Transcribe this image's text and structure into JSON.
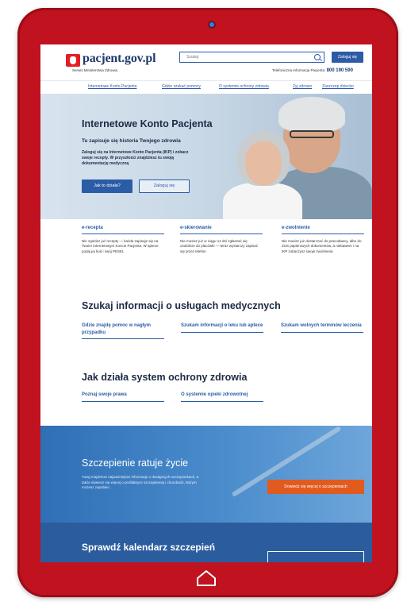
{
  "header": {
    "logo": "pacjent.gov.pl",
    "ministry": "Serwis Ministerstwa Zdrowia",
    "search_placeholder": "Szukaj",
    "login_label": "Zaloguj się",
    "phone_label": "Telefoniczna Informacja Pacjenta:",
    "phone_number": "800 190 590"
  },
  "nav": [
    "Internetowe Konto Pacjenta",
    "Gdzie szukać pomocy",
    "O systemie ochrony zdrowia",
    "Żyj zdrowo",
    "Zaszczep dziecko"
  ],
  "hero": {
    "title": "Internetowe Konto Pacjenta",
    "subtitle": "Tu zapisuje się historia Twojego zdrowia",
    "desc": "Zaloguj się na Internetowe Konto Pacjenta (IKP) i zobacz swoje recepty. W przyszłości znajdziesz tu swoją dokumentację medyczną",
    "btn_how": "Jak to działa?",
    "btn_login": "Zaloguj się"
  },
  "cards": [
    {
      "title": "e-recepta",
      "text": "Nie zgubisz już recepty — każda zapisuje się na Twoim Internetowym Koncie Pacjenta. W aptece podaj jej kod i swój PESEL"
    },
    {
      "title": "e-skierowanie",
      "text": "Nie musisz już w ciągu 14 dni zgłaszać się osobiście do placówki — teraz wystarczy zapisać się przez telefon"
    },
    {
      "title": "e-zwolnienie",
      "text": "Nie musisz już dostarczać do pracodawcy, albo do ZUS papierowych dokumentów, a niebawem i na IKP zobaczysz swoje zwolnienia"
    }
  ],
  "services": {
    "title": "Szukaj informacji o usługach medycznych",
    "links": [
      "Gdzie znajdę pomoc w nagłym przypadku",
      "Szukam informacji o leku lub aptece",
      "Szukam wolnych terminów leczenia"
    ]
  },
  "system": {
    "title": "Jak działa system ochrony zdrowia",
    "links": [
      "Poznaj swoje prawa",
      "O systemie opieki zdrowotnej"
    ]
  },
  "vaccination": {
    "title": "Szczepienie ratuje życie",
    "text": "Tutaj znajdziesz najważniejsze informacje o dostępnych szczepionkach, a także dowiesz się więcej o profilaktyce szczepiennej i chorobach, którym możesz zapobiec.",
    "button": "Dowiedz się więcej o szczepieniach"
  },
  "calendar": {
    "title": "Sprawdź kalendarz szczepień"
  },
  "colors": {
    "frame": "#c1121f",
    "brand_blue": "#2b5ca6",
    "accent_orange": "#e15a1e"
  }
}
